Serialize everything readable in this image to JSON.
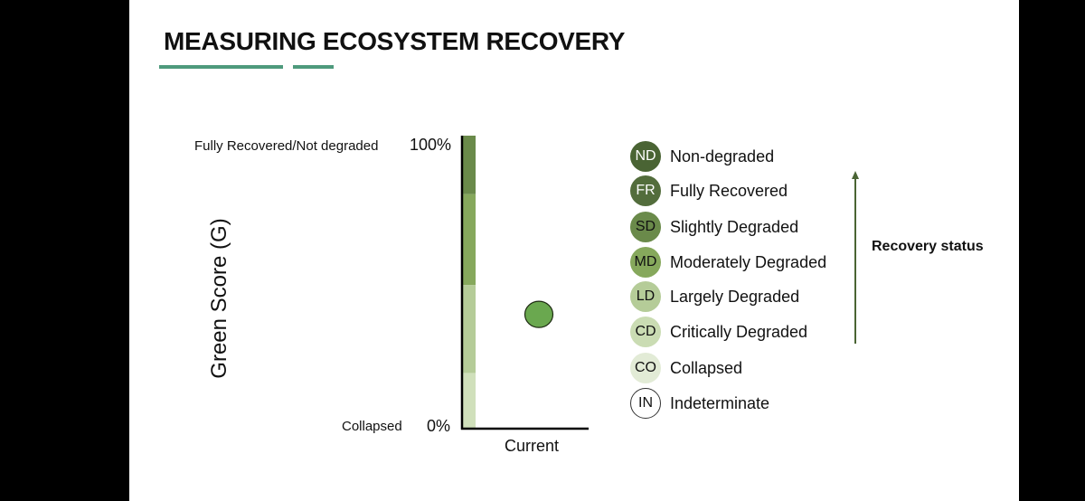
{
  "slide": {
    "title": "MEASURING ECOSYSTEM RECOVERY",
    "accent_color": "#4e9a7c"
  },
  "chart_data": {
    "type": "scatter",
    "title": "",
    "ylabel": "Green Score (G)",
    "xlabel": "Current",
    "ylim": [
      0,
      100
    ],
    "y_ticks": [
      {
        "value": 100,
        "pct_label": "100%",
        "name_label": "Fully Recovered/Not degraded"
      },
      {
        "value": 0,
        "pct_label": "0%",
        "name_label": "Collapsed"
      }
    ],
    "categories": [
      "Current"
    ],
    "points": [
      {
        "x": "Current",
        "y": 39,
        "color": "#6aa84f"
      }
    ],
    "bands": [
      {
        "from": 80,
        "to": 100,
        "color": "#6a8a4a"
      },
      {
        "from": 49,
        "to": 80,
        "color": "#86a85c"
      },
      {
        "from": 19,
        "to": 49,
        "color": "#b5cc98"
      },
      {
        "from": 0,
        "to": 19,
        "color": "#d0e0bb"
      }
    ],
    "grid": false
  },
  "legend": {
    "items": [
      {
        "code": "ND",
        "label": "Non-degraded",
        "fill": "#4a6434",
        "text_color": "#ffffff"
      },
      {
        "code": "FR",
        "label": "Fully Recovered",
        "fill": "#536d3c",
        "text_color": "#ffffff"
      },
      {
        "code": "SD",
        "label": "Slightly Degraded",
        "fill": "#6a8a4a",
        "text_color": "#111111"
      },
      {
        "code": "MD",
        "label": "Moderately Degraded",
        "fill": "#86a85c",
        "text_color": "#111111"
      },
      {
        "code": "LD",
        "label": "Largely Degraded",
        "fill": "#b5cc98",
        "text_color": "#111111"
      },
      {
        "code": "CD",
        "label": "Critically Degraded",
        "fill": "#cadcb3",
        "text_color": "#111111"
      },
      {
        "code": "CO",
        "label": "Collapsed",
        "fill": "#e2ebd6",
        "text_color": "#111111"
      },
      {
        "code": "IN",
        "label": "Indeterminate",
        "fill": "#ffffff",
        "text_color": "#111111",
        "outlined": true
      }
    ],
    "arrow_label": "Recovery status",
    "arrow_color": "#4a6434"
  }
}
